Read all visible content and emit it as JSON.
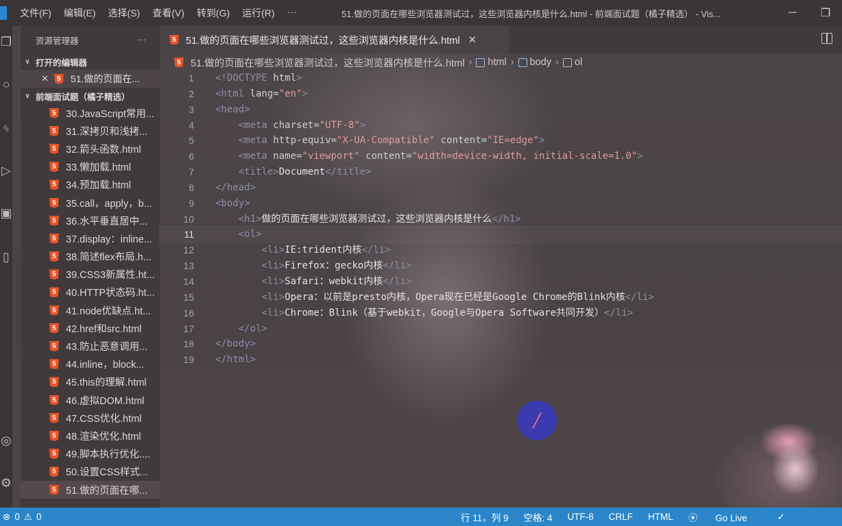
{
  "titlebar": {
    "menu": [
      "文件(F)",
      "编辑(E)",
      "选择(S)",
      "查看(V)",
      "转到(G)",
      "运行(R)",
      "···"
    ],
    "window_title": "51.做的页面在哪些浏览器测试过，这些浏览器内核是什么.html - 前端面试题（橘子精选） - Vis...",
    "minimize": "─",
    "restore": "❐"
  },
  "sidebar": {
    "header": "资源管理器",
    "more": "···",
    "open_editors_label": "打开的编辑器",
    "open_editor_file": "51.做的页面在...",
    "project_label": "前端面试题（橘子精选）",
    "files": [
      "30.JavaScript常用...",
      "31.深拷贝和浅拷...",
      "32.箭头函数.html",
      "33.懒加载.html",
      "34.预加载.html",
      "35.call，apply，b...",
      "36.水平垂直居中...",
      "37.display：inline...",
      "38.简述flex布局.h...",
      "39.CSS3新属性.ht...",
      "40.HTTP状态码.ht...",
      "41.node优缺点.ht...",
      "42.href和src.html",
      "43.防止恶意调用...",
      "44.inline，block...",
      "45.this的理解.html",
      "46.虚拟DOM.html",
      "47.CSS优化.html",
      "48.渲染优化.html",
      "49.脚本执行优化....",
      "50.设置CSS样式...",
      "51.做的页面在哪..."
    ],
    "active_file_index": 21
  },
  "editor": {
    "tab_label": "51.做的页面在哪些浏览器测试过，这些浏览器内核是什么.html",
    "tab_close": "✕",
    "breadcrumb": {
      "file": "51.做的页面在哪些浏览器测试过，这些浏览器内核是什么.html",
      "items": [
        "html",
        "body",
        "ol"
      ]
    },
    "current_line": 11,
    "lines": [
      [
        [
          "tg",
          "<!DOCTYPE "
        ],
        [
          "kw",
          "html"
        ],
        [
          "tg",
          ">"
        ]
      ],
      [
        [
          "tg",
          "<html "
        ],
        [
          "at",
          "lang="
        ],
        [
          "st",
          "\"en\""
        ],
        [
          "tg",
          ">"
        ]
      ],
      [
        [
          "tg",
          "<head>"
        ]
      ],
      [
        [
          "tx",
          "    "
        ],
        [
          "tg",
          "<meta "
        ],
        [
          "at",
          "charset="
        ],
        [
          "st",
          "\"UTF-8\""
        ],
        [
          "tg",
          ">"
        ]
      ],
      [
        [
          "tx",
          "    "
        ],
        [
          "tg",
          "<meta "
        ],
        [
          "at",
          "http-equiv="
        ],
        [
          "st",
          "\"X-UA-Compatible\""
        ],
        [
          "at",
          " content="
        ],
        [
          "st",
          "\"IE=edge\""
        ],
        [
          "tg",
          ">"
        ]
      ],
      [
        [
          "tx",
          "    "
        ],
        [
          "tg",
          "<meta "
        ],
        [
          "at",
          "name="
        ],
        [
          "st",
          "\"viewport\""
        ],
        [
          "at",
          " content="
        ],
        [
          "st",
          "\"width=device-width, initial-scale=1.0\""
        ],
        [
          "tg",
          ">"
        ]
      ],
      [
        [
          "tx",
          "    "
        ],
        [
          "tg",
          "<title>"
        ],
        [
          "tx",
          "Document"
        ],
        [
          "tg",
          "</title>"
        ]
      ],
      [
        [
          "tg",
          "</head>"
        ]
      ],
      [
        [
          "tg",
          "<body>"
        ]
      ],
      [
        [
          "tx",
          "    "
        ],
        [
          "tg",
          "<h1>"
        ],
        [
          "tx",
          "做的页面在哪些浏览器测试过，这些浏览器内核是什么"
        ],
        [
          "tg",
          "</h1>"
        ]
      ],
      [
        [
          "tx",
          "    "
        ],
        [
          "tg",
          "<ol>"
        ]
      ],
      [
        [
          "tx",
          "        "
        ],
        [
          "tg",
          "<li>"
        ],
        [
          "tx",
          "IE:trident内核"
        ],
        [
          "tg",
          "</li>"
        ]
      ],
      [
        [
          "tx",
          "        "
        ],
        [
          "tg",
          "<li>"
        ],
        [
          "tx",
          "Firefox：gecko内核"
        ],
        [
          "tg",
          "</li>"
        ]
      ],
      [
        [
          "tx",
          "        "
        ],
        [
          "tg",
          "<li>"
        ],
        [
          "tx",
          "Safari：webkit内核"
        ],
        [
          "tg",
          "</li>"
        ]
      ],
      [
        [
          "tx",
          "        "
        ],
        [
          "tg",
          "<li>"
        ],
        [
          "tx",
          "Opera：以前是presto内核，Opera现在已经是Google Chrome的Blink内核"
        ],
        [
          "tg",
          "</li>"
        ]
      ],
      [
        [
          "tx",
          "        "
        ],
        [
          "tg",
          "<li>"
        ],
        [
          "tx",
          "Chrome：Blink（基于webkit，Google与Opera Software共同开发）"
        ],
        [
          "tg",
          "</li>"
        ]
      ],
      [
        [
          "tx",
          "    "
        ],
        [
          "tg",
          "</ol>"
        ]
      ],
      [
        [
          "tg",
          "</body>"
        ]
      ],
      [
        [
          "tg",
          "</html>"
        ]
      ]
    ]
  },
  "statusbar": {
    "errors": "0",
    "warnings": "0",
    "position": "行 11，列 9",
    "spaces": "空格: 4",
    "encoding": "UTF-8",
    "eol": "CRLF",
    "language": "HTML",
    "golive": "Go Live"
  },
  "colors": {
    "statusbar": "#2a86c9",
    "html_icon": "#e4552b"
  }
}
